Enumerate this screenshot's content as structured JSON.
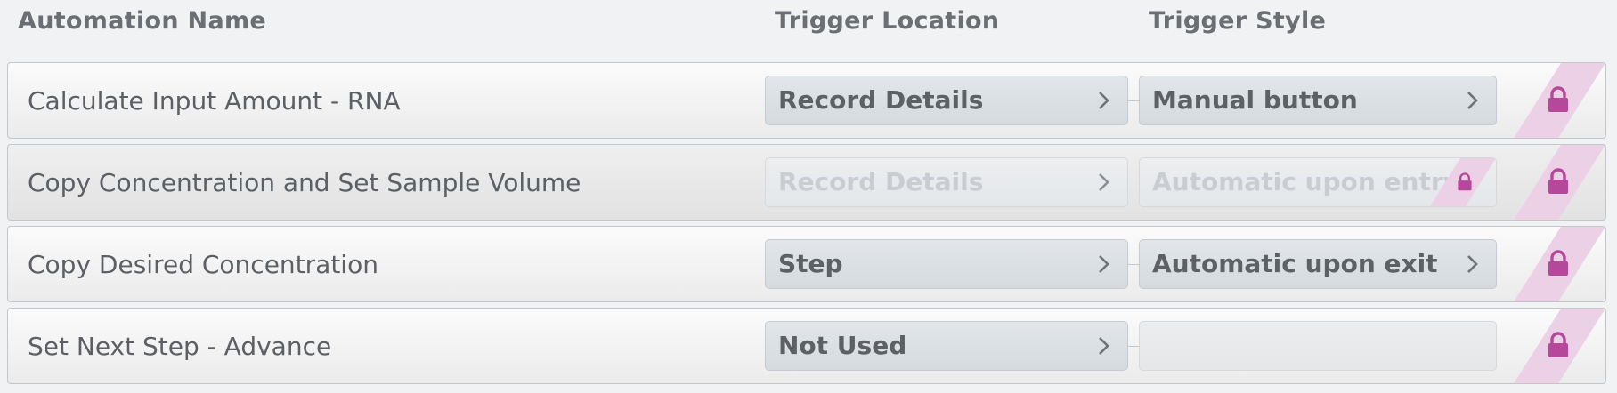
{
  "headers": {
    "name": "Automation Name",
    "location": "Trigger Location",
    "style": "Trigger Style"
  },
  "rows": [
    {
      "name": "Calculate Input Amount - RNA",
      "location": "Record Details",
      "style": "Manual button",
      "disabled": false
    },
    {
      "name": "Copy Concentration and Set Sample Volume",
      "location": "Record Details",
      "style": "Automatic upon entry",
      "disabled": true
    },
    {
      "name": "Copy Desired Concentration",
      "location": "Step",
      "style": "Automatic upon exit",
      "disabled": false
    },
    {
      "name": "Set Next Step - Advance",
      "location": "Not Used",
      "style": "",
      "disabled": false
    }
  ],
  "colors": {
    "lock": "#b5489a",
    "lock_stripe": "#ecd1e6"
  },
  "icons": {
    "chevron": "chevron-right-icon",
    "lock": "lock-icon"
  }
}
